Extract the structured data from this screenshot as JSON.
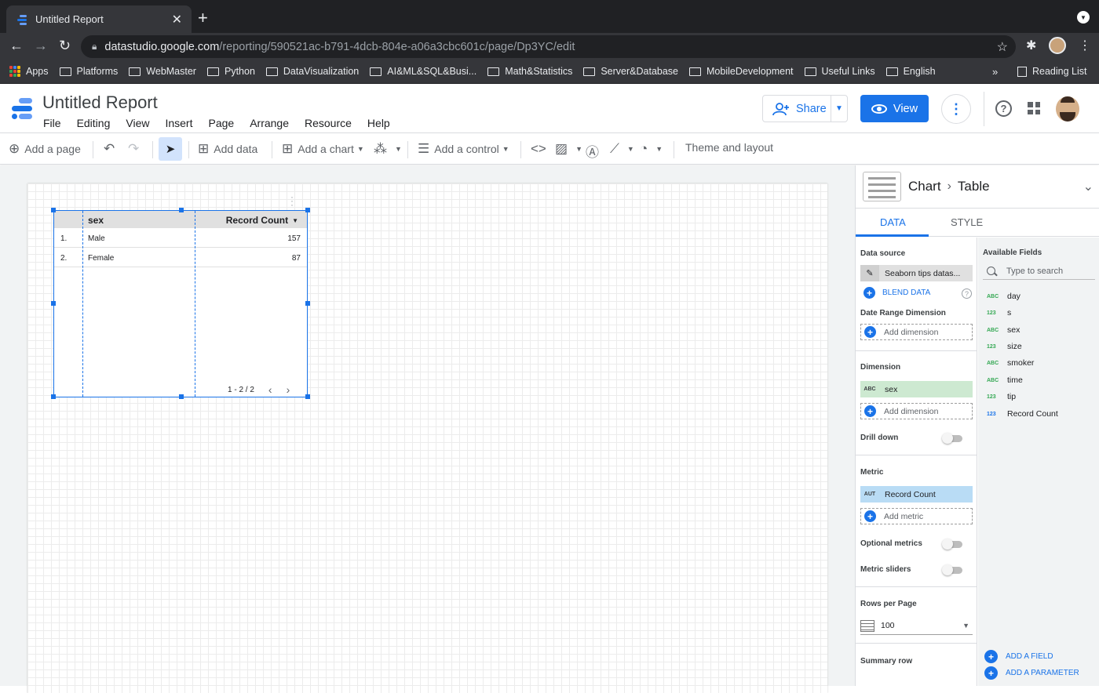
{
  "browser": {
    "tab_title": "Untitled Report",
    "url_host": "datastudio.google.com",
    "url_path": "/reporting/590521ac-b791-4dcb-804e-a06a3cbc601c/page/Dp3YC/edit",
    "bookmarks": [
      "Apps",
      "Platforms",
      "WebMaster",
      "Python",
      "DataVisualization",
      "AI&ML&SQL&Busi...",
      "Math&Statistics",
      "Server&Database",
      "MobileDevelopment",
      "Useful Links",
      "English"
    ],
    "more_bookmarks": "»",
    "reading_list": "Reading List"
  },
  "app": {
    "title": "Untitled Report",
    "menu": [
      "File",
      "Editing",
      "View",
      "Insert",
      "Page",
      "Arrange",
      "Resource",
      "Help"
    ],
    "share_label": "Share",
    "view_label": "View"
  },
  "toolbar": {
    "add_page": "Add a page",
    "add_data": "Add data",
    "add_chart": "Add a chart",
    "add_control": "Add a control",
    "theme_layout": "Theme and layout"
  },
  "table": {
    "headers": {
      "dimension": "sex",
      "metric": "Record Count"
    },
    "rows": [
      {
        "index": "1.",
        "sex": "Male",
        "count": "157"
      },
      {
        "index": "2.",
        "sex": "Female",
        "count": "87"
      }
    ],
    "pagination": "1 - 2 / 2"
  },
  "panel": {
    "chart_label": "Chart",
    "chart_type": "Table",
    "tabs": [
      "DATA",
      "STYLE"
    ],
    "data_source_label": "Data source",
    "data_source_name": "Seaborn tips datas...",
    "blend_data": "BLEND DATA",
    "date_range_label": "Date Range Dimension",
    "add_dimension": "Add dimension",
    "dimension_label": "Dimension",
    "dimension_field": {
      "type": "ABC",
      "name": "sex"
    },
    "drill_down": "Drill down",
    "metric_label": "Metric",
    "metric_field": {
      "type": "AUT",
      "name": "Record Count"
    },
    "add_metric": "Add metric",
    "optional_metrics": "Optional metrics",
    "metric_sliders": "Metric sliders",
    "rows_per_page_label": "Rows per Page",
    "rows_per_page_value": "100",
    "summary_row_label": "Summary row",
    "available_fields_label": "Available Fields",
    "search_placeholder": "Type to search",
    "fields": [
      {
        "type": "ABC",
        "name": "day",
        "color": "#34a853"
      },
      {
        "type": "123",
        "name": "s",
        "color": "#34a853"
      },
      {
        "type": "ABC",
        "name": "sex",
        "color": "#34a853"
      },
      {
        "type": "123",
        "name": "size",
        "color": "#34a853"
      },
      {
        "type": "ABC",
        "name": "smoker",
        "color": "#34a853"
      },
      {
        "type": "ABC",
        "name": "time",
        "color": "#34a853"
      },
      {
        "type": "123",
        "name": "tip",
        "color": "#34a853"
      },
      {
        "type": "123",
        "name": "Record Count",
        "color": "#1a73e8"
      }
    ],
    "add_field": "ADD A FIELD",
    "add_parameter": "ADD A PARAMETER"
  },
  "colors": {
    "accent": "#1a73e8",
    "dimension_chip": "#cde9d1",
    "metric_chip": "#b9dcf5"
  }
}
